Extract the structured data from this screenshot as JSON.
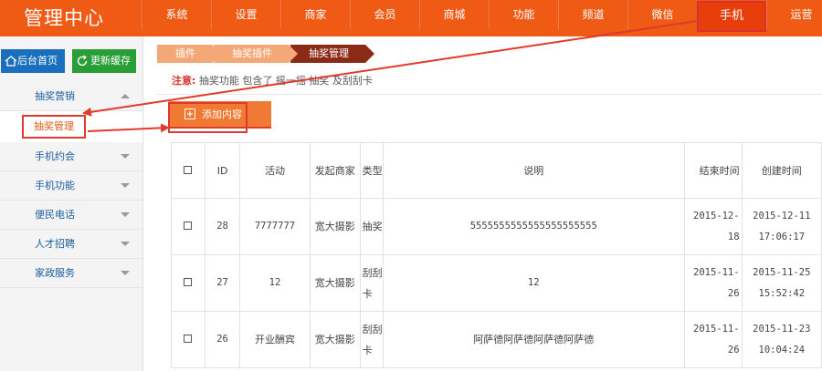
{
  "header": {
    "logo": "管理中心",
    "nav": [
      "系统",
      "设置",
      "商家",
      "会员",
      "商城",
      "功能",
      "频道",
      "微信",
      "手机",
      "运营"
    ],
    "active_nav": "手机"
  },
  "sidebar": {
    "home_button": "后台首页",
    "refresh_button": "更新缓存",
    "group_open": "抽奖营销",
    "selected_sub": "抽奖管理",
    "groups": [
      "手机约会",
      "手机功能",
      "便民电话",
      "人才招聘",
      "家政服务"
    ]
  },
  "breadcrumb": [
    "插件",
    "抽奖插件",
    "抽奖管理"
  ],
  "notice": {
    "label": "注意:",
    "text": "抽奖功能 包含了 摇一摇 抽奖 及刮刮卡"
  },
  "toolbar": {
    "add_label": "添加内容"
  },
  "table": {
    "headers": [
      "ID",
      "活动",
      "发起商家",
      "类型",
      "说明",
      "结束时间",
      "创建时间"
    ],
    "rows": [
      {
        "id": "28",
        "activity": "7777777",
        "merchant": "宽大摄影",
        "type_l1": "抽奖",
        "type_l2": "",
        "desc": "5555555555555555555555",
        "end": "2015-12-18",
        "created_date": "2015-12-11",
        "created_time": "17:06:17"
      },
      {
        "id": "27",
        "activity": "12",
        "merchant": "宽大摄影",
        "type_l1": "刮刮",
        "type_l2": "卡",
        "desc": "12",
        "end": "2015-11-26",
        "created_date": "2015-11-25",
        "created_time": "15:52:42"
      },
      {
        "id": "26",
        "activity": "开业酬宾",
        "merchant": "宽大摄影",
        "type_l1": "刮刮",
        "type_l2": "卡",
        "desc": "阿萨德阿萨德阿萨德阿萨德",
        "end": "2015-11-26",
        "created_date": "2015-11-23",
        "created_time": "10:04:24"
      }
    ]
  },
  "colors": {
    "brand_orange": "#ef5a14",
    "annotation_red": "#e03a2c",
    "home_blue": "#1a6fbc",
    "cache_green": "#2a9e36"
  }
}
